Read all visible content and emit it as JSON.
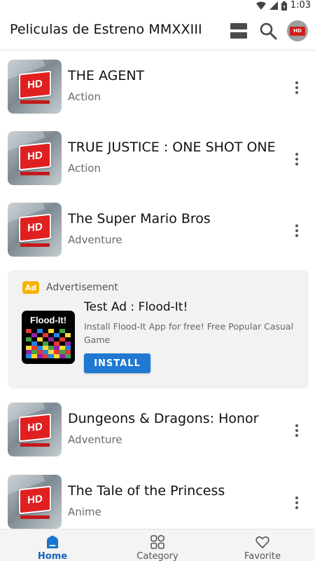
{
  "status_bar": {
    "time": "1:03"
  },
  "app_bar": {
    "title": "Peliculas de Estreno MMXXIII",
    "avatar_text": "HD"
  },
  "movies": [
    {
      "title": "THE AGENT",
      "genre": "Action",
      "thumb_text": "HD"
    },
    {
      "title": "TRUE JUSTICE : ONE SHOT ONE",
      "genre": "Action",
      "thumb_text": "HD"
    },
    {
      "title": "The Super Mario Bros",
      "genre": "Adventure",
      "thumb_text": "HD"
    },
    {
      "title": "Dungeons & Dragons: Honor",
      "genre": "Adventure",
      "thumb_text": "HD"
    },
    {
      "title": "The Tale of the Princess",
      "genre": "Anime",
      "thumb_text": "HD"
    }
  ],
  "ad": {
    "badge": "Ad",
    "label": "Advertisement",
    "icon_title": "Flood-It!",
    "title": "Test Ad : Flood-It!",
    "description": "Install Flood-It App for free! Free Popular Casual Game",
    "cta": "INSTALL"
  },
  "bottom_nav": [
    {
      "label": "Home",
      "icon": "home-icon",
      "active": true
    },
    {
      "label": "Category",
      "icon": "category-icon",
      "active": false
    },
    {
      "label": "Favorite",
      "icon": "heart-icon",
      "active": false
    }
  ],
  "colors": {
    "accent": "#1565c0",
    "install": "#1f78d1",
    "ad_badge": "#f5b301",
    "hd_red": "#e02020"
  }
}
